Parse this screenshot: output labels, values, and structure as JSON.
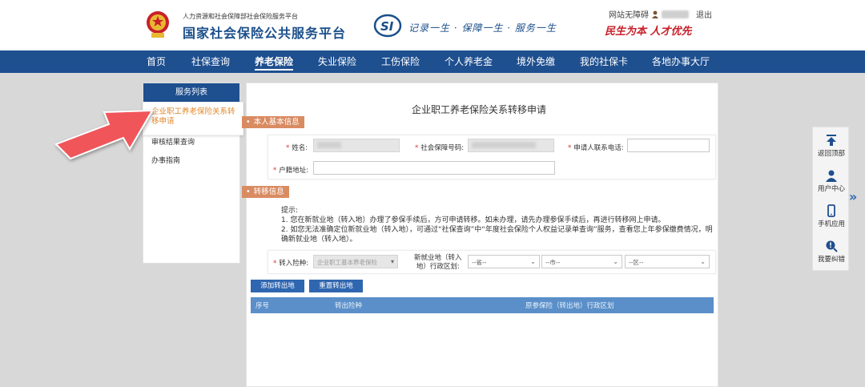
{
  "header": {
    "org_line": "人力资源和社会保障部社会保险服务平台",
    "platform_title": "国家社会保险公共服务平台",
    "si_logo_text": "SI",
    "slogan": "记录一生 · 保障一生 · 服务一生",
    "accessibility": "网站无障碍",
    "logout": "退出",
    "red_slogan": "民生为本  人才优先"
  },
  "nav": {
    "items": [
      "首页",
      "社保查询",
      "养老保险",
      "失业保险",
      "工伤保险",
      "个人养老金",
      "境外免缴",
      "我的社保卡",
      "各地办事大厅"
    ],
    "active": "养老保险"
  },
  "sidebar": {
    "title": "服务列表",
    "items": [
      "企业职工养老保险关系转移申请",
      "审核结果查询",
      "办事指南"
    ]
  },
  "main": {
    "title": "企业职工养老保险关系转移申请",
    "section_basic": "本人基本信息",
    "section_transfer": "转移信息",
    "fields": {
      "name_label": "姓名:",
      "ssn_label": "社会保障号码:",
      "phone_label": "申请人联系电话:",
      "hukou_label": "户籍地址:",
      "insurance_label": "转入险种:",
      "insurance_value": "企业职工基本养老保险",
      "region_label_1": "新就业地（转入",
      "region_label_2": "地）行政区划:",
      "province_placeholder": "--省--",
      "city_placeholder": "--市--",
      "district_placeholder": "--区--"
    },
    "hint": {
      "title": "提示:",
      "line1": "1. 您在新就业地（转入地）办理了参保手续后，方可申请转移。如未办理，请先办理参保手续后，再进行转移网上申请。",
      "line2": "2. 如您无法准确定位新就业地（转入地），可通过“社保查询”中“年度社会保险个人权益记录单查询”服务，查看您上年参保缴费情况，明确新就业地（转入地）。"
    },
    "buttons": {
      "add_out": "添加转出地",
      "reset_out": "重置转出地"
    },
    "table_headers": [
      "序号",
      "转出险种",
      "原参保险（转出地）行政区划"
    ]
  },
  "float_bar": {
    "items": [
      "返回顶部",
      "用户中心",
      "手机应用",
      "我要纠错"
    ],
    "expand": "»"
  },
  "colors": {
    "nav_bg": "#1e4f8f",
    "accent_orange": "#e08a2e",
    "section_tag": "#d98b62",
    "arrow_red": "#f0545a",
    "button_blue": "#2f66b0",
    "table_head": "#5a8fc9"
  }
}
